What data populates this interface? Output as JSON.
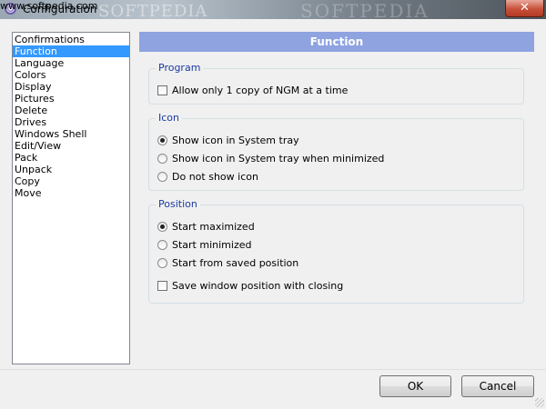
{
  "window": {
    "title": "Configuration",
    "close_label": "✕",
    "watermark": "SOFTPEDIA",
    "watermark_url": "www.softpedia.com"
  },
  "sidebar": {
    "items": [
      {
        "label": "Confirmations",
        "selected": false
      },
      {
        "label": "Function",
        "selected": true
      },
      {
        "label": "Language",
        "selected": false
      },
      {
        "label": "Colors",
        "selected": false
      },
      {
        "label": "Display",
        "selected": false
      },
      {
        "label": "Pictures",
        "selected": false
      },
      {
        "label": "Delete",
        "selected": false
      },
      {
        "label": "Drives",
        "selected": false
      },
      {
        "label": "Windows Shell",
        "selected": false
      },
      {
        "label": "Edit/View",
        "selected": false
      },
      {
        "label": "Pack",
        "selected": false
      },
      {
        "label": "Unpack",
        "selected": false
      },
      {
        "label": "Copy",
        "selected": false
      },
      {
        "label": "Move",
        "selected": false
      }
    ]
  },
  "main": {
    "header": "Function",
    "program": {
      "legend": "Program",
      "allow_one_copy": {
        "label": "Allow only 1 copy of NGM at a time",
        "checked": false
      }
    },
    "icon": {
      "legend": "Icon",
      "options": [
        {
          "label": "Show icon in System tray",
          "checked": true
        },
        {
          "label": "Show icon in System tray when minimized",
          "checked": false
        },
        {
          "label": "Do not show icon",
          "checked": false
        }
      ]
    },
    "position": {
      "legend": "Position",
      "options": [
        {
          "label": "Start maximized",
          "checked": true
        },
        {
          "label": "Start minimized",
          "checked": false
        },
        {
          "label": "Start from saved position",
          "checked": false
        }
      ],
      "save_position": {
        "label": "Save window position with closing",
        "checked": false
      }
    }
  },
  "footer": {
    "ok_label": "OK",
    "cancel_label": "Cancel"
  },
  "colors": {
    "header_bg": "#8fa3e0",
    "selection": "#3399ff",
    "legend_text": "#1a3aa0",
    "close_button": "#c7503a"
  }
}
